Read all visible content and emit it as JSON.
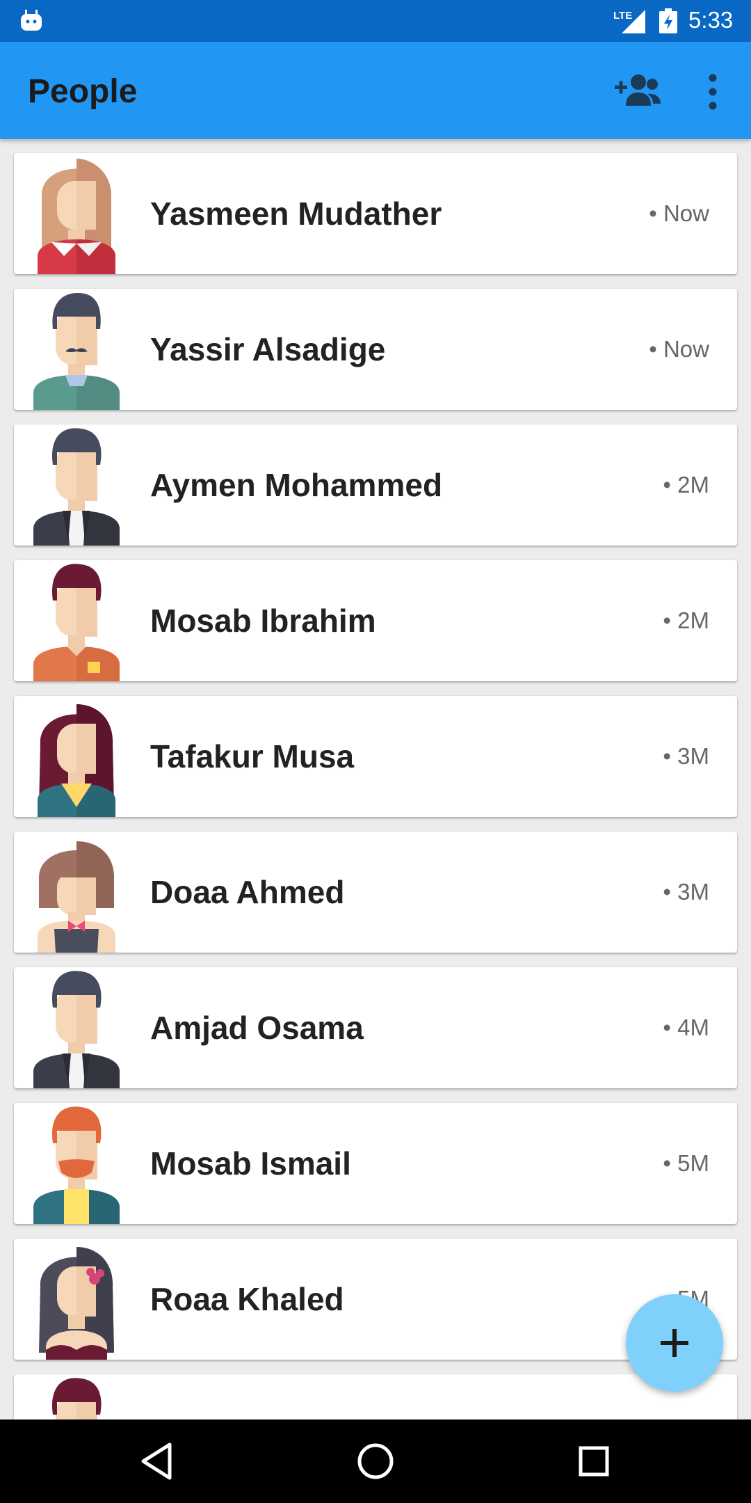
{
  "status_bar": {
    "network": "LTE",
    "time": "5:33",
    "icons": [
      "android-robot-icon",
      "signal-icon",
      "battery-charging-icon"
    ]
  },
  "app_bar": {
    "title": "People",
    "actions": [
      "add-person-icon",
      "more-vert-icon"
    ]
  },
  "colors": {
    "status_bar": "#0868c3",
    "app_bar": "#2196f3",
    "fab": "#7fd0fb",
    "nav_bar": "#000000"
  },
  "people": [
    {
      "name": "Yasmeen Mudather",
      "time": "• Now",
      "avatar": "female-red-shirt-avatar"
    },
    {
      "name": "Yassir Alsadige",
      "time": "• Now",
      "avatar": "male-mustache-avatar"
    },
    {
      "name": "Aymen Mohammed",
      "time": "• 2M",
      "avatar": "male-suit-avatar"
    },
    {
      "name": "Mosab Ibrahim",
      "time": "• 2M",
      "avatar": "male-orange-shirt-avatar"
    },
    {
      "name": "Tafakur Musa",
      "time": "• 3M",
      "avatar": "female-long-hair-avatar"
    },
    {
      "name": "Doaa Ahmed",
      "time": "• 3M",
      "avatar": "female-bowtie-avatar"
    },
    {
      "name": "Amjad Osama",
      "time": "• 4M",
      "avatar": "male-suit-avatar"
    },
    {
      "name": "Mosab Ismail",
      "time": "• 5M",
      "avatar": "male-ginger-beard-avatar"
    },
    {
      "name": "Roaa Khaled",
      "time": "• 5M",
      "avatar": "female-flower-avatar"
    },
    {
      "name": "",
      "time": "",
      "avatar": "male-dark-red-hair-avatar"
    }
  ],
  "fab": {
    "icon": "plus-icon"
  },
  "nav_bar": {
    "buttons": [
      "back-icon",
      "home-icon",
      "recents-icon"
    ]
  }
}
